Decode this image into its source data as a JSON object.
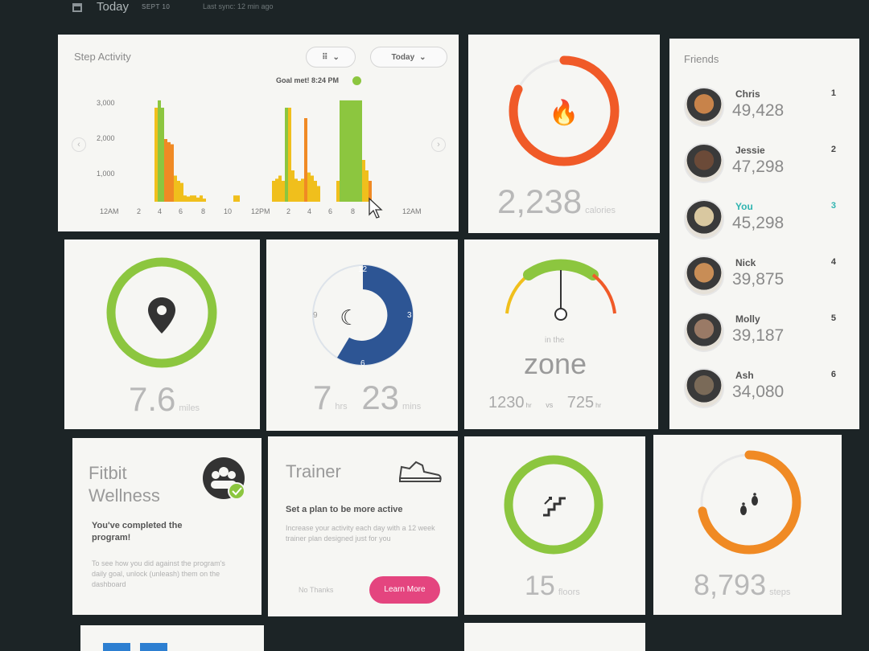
{
  "topbar": {
    "title": "Today",
    "date": "SEPT 10",
    "sync": "Last sync: 12 min ago"
  },
  "steps": {
    "title": "Step Activity",
    "icon_filter": "steps-filter-icon",
    "range_label": "Today",
    "goal_label": "Goal met! 8:24 PM",
    "ylabels": [
      "3,000",
      "2,000",
      "1,000"
    ],
    "xlabels": [
      "12AM",
      "2",
      "4",
      "6",
      "8",
      "10",
      "12PM",
      "2",
      "4",
      "6",
      "8",
      "12AM"
    ],
    "colors": {
      "green": "#8cc63f",
      "orange": "#f08a24",
      "yellow": "#f0bf1c"
    }
  },
  "calories": {
    "value": "2,238",
    "unit": "calories",
    "progress": 0.82,
    "color": "#f05a28"
  },
  "distance": {
    "value": "7.6",
    "unit": "miles",
    "progress": 1.0,
    "color": "#8cc63f"
  },
  "sleep": {
    "hours": "7",
    "hours_unit": "hrs",
    "minutes": "23",
    "minutes_unit": "mins",
    "clock_labels": [
      "12",
      "3",
      "6",
      "9"
    ],
    "color": "#2d5594"
  },
  "zone": {
    "caption": "in the",
    "title": "zone",
    "left_value": "1230",
    "left_unit": "hr",
    "separator": "vs",
    "right_value": "725",
    "right_unit": "hr"
  },
  "friends": {
    "title": "Friends",
    "list": [
      {
        "name": "Chris",
        "steps": "49,428",
        "rank": "1"
      },
      {
        "name": "Jessie",
        "steps": "47,298",
        "rank": "2"
      },
      {
        "name": "You",
        "steps": "45,298",
        "rank": "3"
      },
      {
        "name": "Nick",
        "steps": "39,875",
        "rank": "4"
      },
      {
        "name": "Molly",
        "steps": "39,187",
        "rank": "5"
      },
      {
        "name": "Ash",
        "steps": "34,080",
        "rank": "6"
      }
    ]
  },
  "wellness": {
    "title_line1": "Fitbit",
    "title_line2": "Wellness",
    "completed": "You've completed the program!",
    "body": "To see how you did against the program's daily goal, unlock (unleash) them on the dashboard"
  },
  "trainer": {
    "title": "Trainer",
    "headline": "Set a plan to be more active",
    "body": "Increase your activity each day with a 12 week trainer plan designed just for you",
    "secondary": "No Thanks",
    "cta": "Learn More"
  },
  "floors": {
    "value": "15",
    "unit": "floors",
    "progress": 1.0,
    "color": "#8cc63f"
  },
  "footsteps": {
    "value": "8,793",
    "unit": "steps",
    "progress": 0.72,
    "color": "#f08a24"
  }
}
